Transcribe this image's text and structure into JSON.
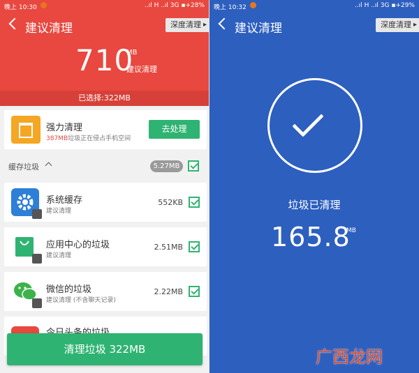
{
  "left": {
    "status": {
      "time": "晚上 10:30",
      "right": "..ıl H ..ıl 3G  ▪+28%"
    },
    "title": "建议清理",
    "deep_clean": "深度清理",
    "total": {
      "value": "710",
      "unit": "MB",
      "label": "建议清理"
    },
    "selected": "已选择:322MB",
    "force": {
      "title": "强力清理",
      "sub_highlight": "387MB",
      "sub_text": "垃圾正在侵占手机空间",
      "button": "去处理"
    },
    "section": {
      "label": "缓存垃圾",
      "size": "5.27MB"
    },
    "items": [
      {
        "title": "系统缓存",
        "sub": "建议清理",
        "size": "552KB",
        "icon": "gear-icon",
        "checked": true
      },
      {
        "title": "应用中心的垃圾",
        "sub": "建议清理",
        "size": "2.51MB",
        "icon": "shopping-bag-icon",
        "checked": true
      },
      {
        "title": "微信的垃圾",
        "sub": "建议清理 (不含聊天记录)",
        "size": "2.22MB",
        "icon": "wechat-icon",
        "checked": true
      },
      {
        "title": "今日头条的垃圾",
        "sub": "",
        "size": "",
        "icon": "news-icon",
        "checked": true
      }
    ],
    "clean_button": "清理垃圾 322MB",
    "colors": {
      "header": "#e8483f",
      "accent": "#2fb372"
    }
  },
  "right": {
    "status": {
      "time": "晚上 10:32",
      "right": "..ıl H ..ıl 3G  ▪+29%"
    },
    "title": "建议清理",
    "deep_clean": "深度清理",
    "done_label": "垃圾已清理",
    "done_value": "165.8",
    "done_unit": "MB",
    "colors": {
      "background": "#2d5fbf"
    }
  },
  "watermark": "广西龙网"
}
